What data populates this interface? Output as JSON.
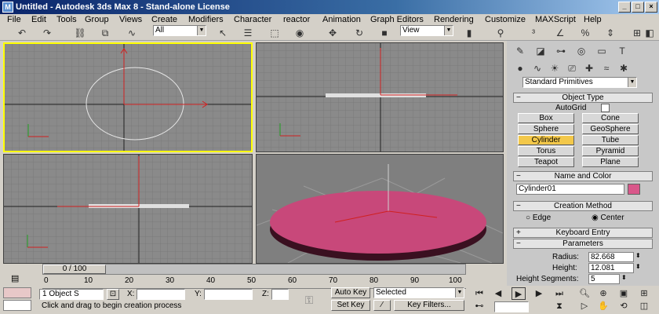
{
  "window": {
    "title": "Untitled - Autodesk 3ds Max 8 - Stand-alone License"
  },
  "menu": [
    "File",
    "Edit",
    "Tools",
    "Group",
    "Views",
    "Create",
    "Modifiers",
    "Character",
    "reactor",
    "Animation",
    "Graph Editors",
    "Rendering",
    "Customize",
    "MAXScript",
    "Help"
  ],
  "toolbar": {
    "selection_filter": "All",
    "ref_coord": "View"
  },
  "panel": {
    "category": "Standard Primitives",
    "object_type": {
      "header": "Object Type",
      "autogrid": "AutoGrid",
      "buttons": [
        "Box",
        "Cone",
        "Sphere",
        "GeoSphere",
        "Cylinder",
        "Tube",
        "Torus",
        "Pyramid",
        "Teapot",
        "Plane"
      ],
      "active": "Cylinder"
    },
    "name_color": {
      "header": "Name and Color",
      "name": "Cylinder01",
      "color": "#d9578a"
    },
    "creation_method": {
      "header": "Creation Method",
      "edge": "Edge",
      "center": "Center",
      "selected": "Center"
    },
    "keyboard_entry": {
      "header": "Keyboard Entry"
    },
    "parameters": {
      "header": "Parameters",
      "radius_label": "Radius:",
      "radius": "82.668",
      "height_label": "Height:",
      "height": "12.081",
      "segs_label": "Height Segments:",
      "segs": "5"
    }
  },
  "timeline": {
    "frame": "0 / 100",
    "ticks": [
      "0",
      "10",
      "20",
      "30",
      "40",
      "50",
      "60",
      "70",
      "80",
      "90",
      "100"
    ]
  },
  "status": {
    "selection": "1 Object S",
    "x_label": "X:",
    "y_label": "Y:",
    "z_label": "Z:",
    "prompt": "Click and drag to begin creation process",
    "auto_key": "Auto Key",
    "set_key": "Set Key",
    "key_mode": "Selected",
    "key_filters": "Key Filters..."
  },
  "colors": {
    "viewport_bg": "#8a8a8a",
    "grid": "#787878",
    "axis": "#202020",
    "active_border": "#ffff00",
    "object": "#c8487a"
  }
}
